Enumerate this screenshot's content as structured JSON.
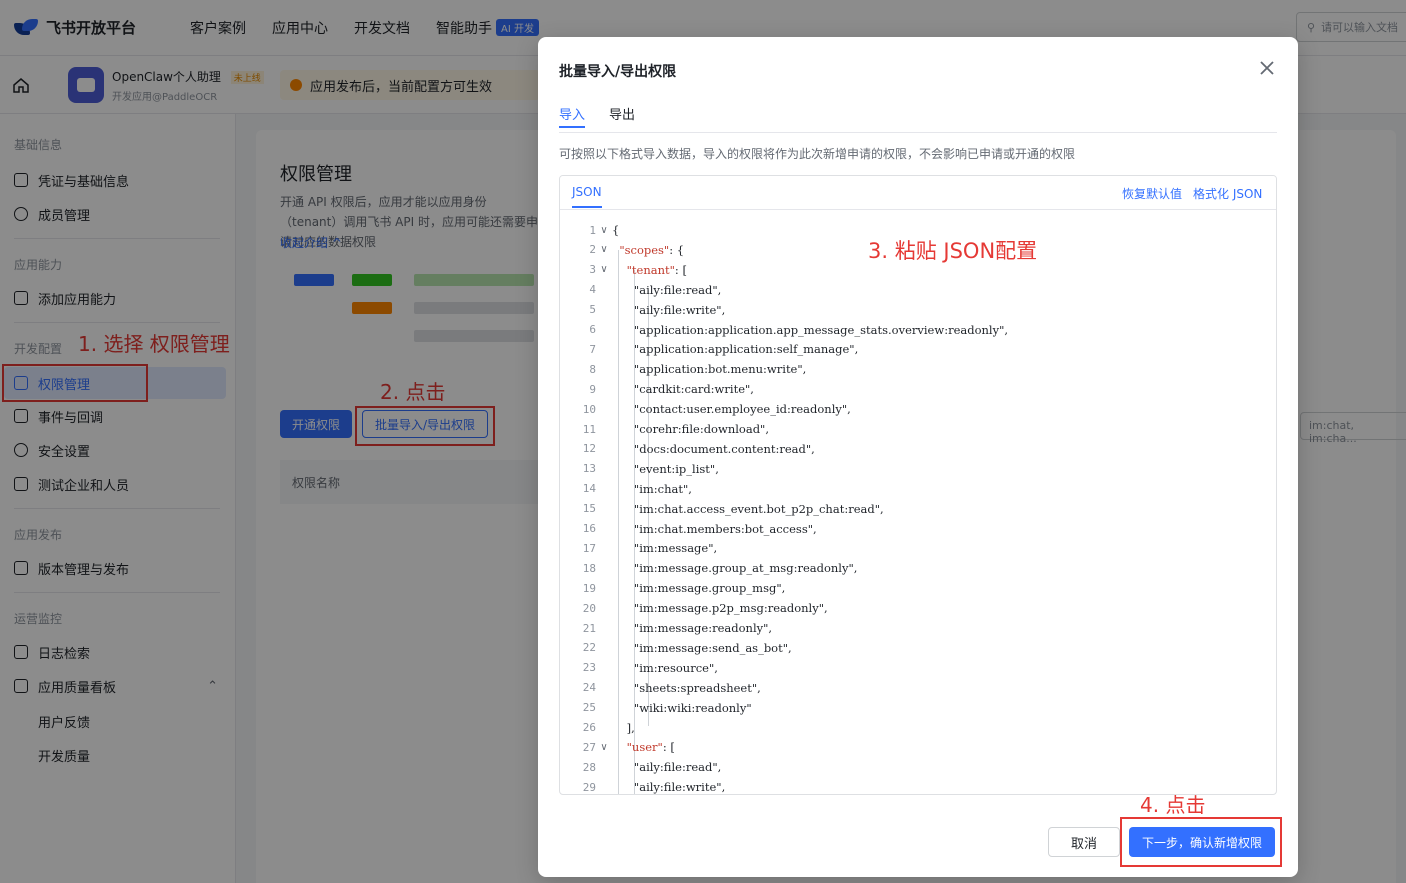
{
  "topnav": {
    "logo_text": "飞书开放平台",
    "items": [
      "客户案例",
      "应用中心",
      "开发文档",
      "智能助手"
    ],
    "ai_badge": "AI 开发",
    "search_placeholder": "请可以输入文档"
  },
  "appbar": {
    "app_name": "OpenClaw个人助理",
    "app_tag": "未上线",
    "app_sub": "开发应用@PaddleOCR",
    "notice": "应用发布后，当前配置方可生效"
  },
  "sidebar": {
    "sections": [
      "基础信息",
      "应用能力",
      "开发配置",
      "应用发布",
      "运营监控"
    ],
    "items": [
      "凭证与基础信息",
      "成员管理",
      "添加应用能力",
      "权限管理",
      "事件与回调",
      "安全设置",
      "测试企业和人员",
      "版本管理与发布",
      "日志检索",
      "应用质量看板"
    ],
    "subitems": [
      "用户反馈",
      "开发质量"
    ]
  },
  "content": {
    "title": "权限管理",
    "desc": "开通 API 权限后，应用才能以应用身份（tenant）调用飞书 API 时，应用可能还需要申请对应的数据权限",
    "link": "收起介绍 ^",
    "btn_open": "开通权限",
    "btn_batch": "批量导入/导出权限",
    "table_header": "权限名称",
    "right_peek": "im:chat, im:cha..."
  },
  "annotations": {
    "step1": "1. 选择 权限管理",
    "step2": "2. 点击",
    "step3": "3. 粘贴 JSON配置",
    "step4": "4. 点击"
  },
  "modal": {
    "title": "批量导入/导出权限",
    "tabs": [
      "导入",
      "导出"
    ],
    "hint": "可按照以下格式导入数据，导入的权限将作为此次新增申请的权限，不会影响已申请或开通的权限",
    "editor_tab": "JSON",
    "action_reset": "恢复默认值",
    "action_format": "格式化 JSON",
    "code_lines": [
      "{",
      "  \"scopes\": {",
      "    \"tenant\": [",
      "      \"aily:file:read\",",
      "      \"aily:file:write\",",
      "      \"application:application.app_message_stats.overview:readonly\",",
      "      \"application:application:self_manage\",",
      "      \"application:bot.menu:write\",",
      "      \"cardkit:card:write\",",
      "      \"contact:user.employee_id:readonly\",",
      "      \"corehr:file:download\",",
      "      \"docs:document.content:read\",",
      "      \"event:ip_list\",",
      "      \"im:chat\",",
      "      \"im:chat.access_event.bot_p2p_chat:read\",",
      "      \"im:chat.members:bot_access\",",
      "      \"im:message\",",
      "      \"im:message.group_at_msg:readonly\",",
      "      \"im:message.group_msg\",",
      "      \"im:message.p2p_msg:readonly\",",
      "      \"im:message:readonly\",",
      "      \"im:message:send_as_bot\",",
      "      \"im:resource\",",
      "      \"sheets:spreadsheet\",",
      "      \"wiki:wiki:readonly\"",
      "    ],",
      "    \"user\": [",
      "      \"aily:file:read\",",
      "      \"aily:file:write\","
    ],
    "fold_lines": [
      1,
      2,
      3,
      27
    ],
    "btn_cancel": "取消",
    "btn_next": "下一步，确认新增权限"
  },
  "colors": {
    "accent": "#3370ff",
    "annotation_red": "#e53935"
  }
}
